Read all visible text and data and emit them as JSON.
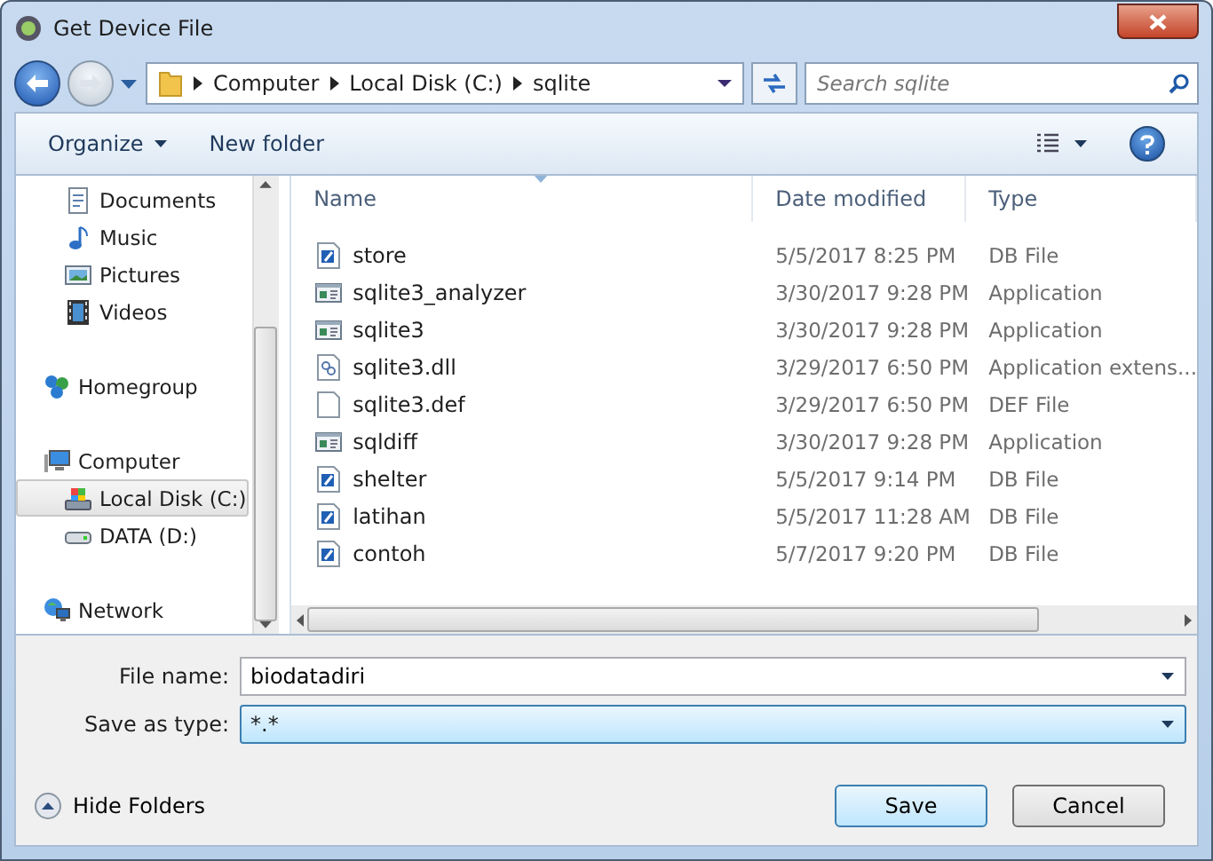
{
  "window": {
    "title": "Get Device File"
  },
  "address": {
    "crumbs": [
      "Computer",
      "Local Disk (C:)",
      "sqlite"
    ]
  },
  "search": {
    "placeholder": "Search sqlite"
  },
  "toolbar": {
    "organize": "Organize",
    "new_folder": "New folder"
  },
  "nav": {
    "sections": [
      {
        "children": [
          {
            "label": "Documents",
            "kind": "documents",
            "selected": false
          },
          {
            "label": "Music",
            "kind": "music",
            "selected": false
          },
          {
            "label": "Pictures",
            "kind": "pictures",
            "selected": false
          },
          {
            "label": "Videos",
            "kind": "videos",
            "selected": false
          }
        ]
      },
      {
        "label": "Homegroup",
        "kind": "homegroup",
        "selected": false
      },
      {
        "label": "Computer",
        "kind": "computer",
        "selected": false,
        "children": [
          {
            "label": "Local Disk (C:)",
            "kind": "disk",
            "selected": true
          },
          {
            "label": "DATA (D:)",
            "kind": "drive",
            "selected": false
          }
        ]
      },
      {
        "label": "Network",
        "kind": "network",
        "selected": false
      }
    ]
  },
  "table": {
    "columns": [
      "Name",
      "Date modified",
      "Type"
    ],
    "rows": [
      {
        "name": "store",
        "date": "5/5/2017 8:25 PM",
        "type": "DB File",
        "kind": "db"
      },
      {
        "name": "sqlite3_analyzer",
        "date": "3/30/2017 9:28 PM",
        "type": "Application",
        "kind": "app"
      },
      {
        "name": "sqlite3",
        "date": "3/30/2017 9:28 PM",
        "type": "Application",
        "kind": "app"
      },
      {
        "name": "sqlite3.dll",
        "date": "3/29/2017 6:50 PM",
        "type": "Application extens...",
        "kind": "dll"
      },
      {
        "name": "sqlite3.def",
        "date": "3/29/2017 6:50 PM",
        "type": "DEF File",
        "kind": "blank"
      },
      {
        "name": "sqldiff",
        "date": "3/30/2017 9:28 PM",
        "type": "Application",
        "kind": "app"
      },
      {
        "name": "shelter",
        "date": "5/5/2017 9:14 PM",
        "type": "DB File",
        "kind": "db"
      },
      {
        "name": "latihan",
        "date": "5/5/2017 11:28 AM",
        "type": "DB File",
        "kind": "db"
      },
      {
        "name": "contoh",
        "date": "5/7/2017 9:20 PM",
        "type": "DB File",
        "kind": "db"
      }
    ]
  },
  "form": {
    "file_name_label": "File name:",
    "file_name": "biodatadiri",
    "type_label": "Save as type:",
    "type_value": "*.*"
  },
  "footer": {
    "hide_folders": "Hide Folders",
    "save": "Save",
    "cancel": "Cancel"
  }
}
